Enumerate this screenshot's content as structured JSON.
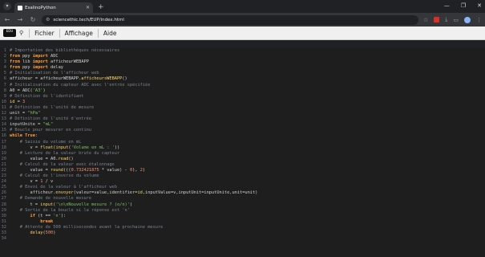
{
  "browser": {
    "tab_title": "EsalinoPython",
    "url": "sciencethic.tech/EUP/index.html"
  },
  "menu": {
    "logo_text": "EDU",
    "items": [
      "Fichier",
      "Affichage",
      "Aide"
    ]
  },
  "code_lines": [
    {
      "n": "1",
      "html": "<span class='cm'># Importation des bibliothèques nécessaires</span>"
    },
    {
      "n": "2",
      "html": "<span class='kw'>from</span> ppy <span class='kw'>import</span> ADC"
    },
    {
      "n": "3",
      "html": "<span class='kw'>from</span> lib <span class='kw'>import</span> afficheurWEBAPP"
    },
    {
      "n": "4",
      "html": "<span class='kw'>from</span> ppy <span class='kw'>import</span> delay"
    },
    {
      "n": "5",
      "html": "<span class='cm'># Initialisation de l'afficheur web</span>"
    },
    {
      "n": "6",
      "html": "afficheur = afficheurWEBAPP.<span class='fn'>afficheursWEBAPP</span>()"
    },
    {
      "n": "7",
      "html": "<span class='cm'># Initialisation du capteur ADC avec l'entrée spécifiée</span>"
    },
    {
      "n": "8",
      "html": "A0 = ADC(<span class='str'>'A3'</span>)"
    },
    {
      "n": "9",
      "html": "<span class='cm'># Définition de l'identifiant</span>"
    },
    {
      "n": "10",
      "html": "<span class='fn'>id</span> = <span class='num'>3</span>"
    },
    {
      "n": "11",
      "html": "<span class='cm'># Définition de l'unité de mesure</span>"
    },
    {
      "n": "12",
      "html": "unit = <span class='str'>\"hPa\"</span>"
    },
    {
      "n": "13",
      "html": "<span class='cm'># Définition de l'unité d'entrée</span>"
    },
    {
      "n": "14",
      "html": "inputUnite = <span class='str'>\"mL\"</span>"
    },
    {
      "n": "15",
      "html": "<span class='cm'># Boucle pour mesurer en continu</span>"
    },
    {
      "n": "16",
      "html": "<span class='kw'>while True</span>:"
    },
    {
      "n": "17",
      "html": "<span class='cm'>    # Saisie du volume en mL</span>"
    },
    {
      "n": "18",
      "html": "        v = <span class='fn'>float</span>(<span class='fn'>input</span>(<span class='str'>'Volume en mL : '</span>))"
    },
    {
      "n": "19",
      "html": "<span class='cm'>    # Lecture de la valeur brute du capteur</span>"
    },
    {
      "n": "20",
      "html": "        value = A0.<span class='fn'>read</span>()"
    },
    {
      "n": "21",
      "html": "<span class='cm'>    # Calcul de la valeur avec étalonnage</span>"
    },
    {
      "n": "22",
      "html": "        value = <span class='fn'>round</span>(((<span class='num'>0.732421875</span> * value) - <span class='num'>0</span>), <span class='num'>2</span>)"
    },
    {
      "n": "23",
      "html": "<span class='cm'>    # Calcul de l'inverse du volume</span>"
    },
    {
      "n": "24",
      "html": "        v = <span class='num'>1</span> / v"
    },
    {
      "n": "25",
      "html": "<span class='cm'>    # Envoi de la valeur à l'afficheur web</span>"
    },
    {
      "n": "26",
      "html": "        afficheur.<span class='fn'>envoyer</span>(valeur=value,identifier=<span class='fn'>id</span>,inputValue=v,inputUnit=inputUnite,unit=unit)"
    },
    {
      "n": "27",
      "html": "<span class='cm'>    # Demande de nouvelle mesure</span>"
    },
    {
      "n": "28",
      "html": "        t = <span class='fn'>input</span>(<span class='str'>'\\n\\nNouvelle mesure ? (o/n)'</span>)"
    },
    {
      "n": "29",
      "html": "<span class='cm'>    # Sortie de la boucle si la réponse est 'n'</span>"
    },
    {
      "n": "30",
      "html": "        <span class='kw'>if</span> (t == <span class='str'>'n'</span>):"
    },
    {
      "n": "31",
      "html": "            <span class='kw'>break</span>"
    },
    {
      "n": "32",
      "html": "<span class='cm'>    # Attente de 500 millisecondes avant la prochaine mesure</span>"
    },
    {
      "n": "33",
      "html": "        <span class='fn'>delay</span>(<span class='num'>500</span>)"
    },
    {
      "n": "34",
      "html": ""
    }
  ]
}
